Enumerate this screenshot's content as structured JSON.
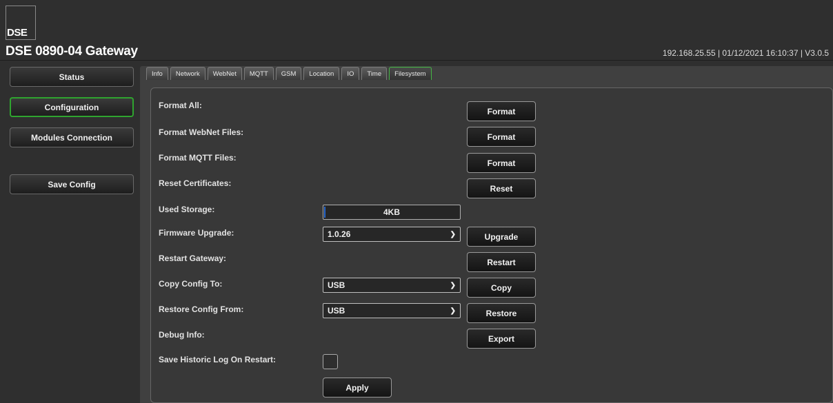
{
  "logo": {
    "text": "DSE"
  },
  "header": {
    "title": "DSE 0890-04 Gateway",
    "status": "192.168.25.55 | 01/12/2021 16:10:37 | V3.0.5"
  },
  "sidebar": {
    "items": [
      {
        "label": "Status"
      },
      {
        "label": "Configuration"
      },
      {
        "label": "Modules Connection"
      },
      {
        "label": "Save Config"
      }
    ]
  },
  "tabs": [
    {
      "label": "Info"
    },
    {
      "label": "Network"
    },
    {
      "label": "WebNet"
    },
    {
      "label": "MQTT"
    },
    {
      "label": "GSM"
    },
    {
      "label": "Location"
    },
    {
      "label": "IO"
    },
    {
      "label": "Time"
    },
    {
      "label": "Filesystem"
    }
  ],
  "filesystem": {
    "format_all": {
      "label": "Format All:",
      "button": "Format"
    },
    "format_webnet": {
      "label": "Format WebNet Files:",
      "button": "Format"
    },
    "format_mqtt": {
      "label": "Format MQTT Files:",
      "button": "Format"
    },
    "reset_certs": {
      "label": "Reset Certificates:",
      "button": "Reset"
    },
    "used_storage": {
      "label": "Used Storage:",
      "value": "4KB"
    },
    "firmware_upgrade": {
      "label": "Firmware Upgrade:",
      "selected": "1.0.26",
      "button": "Upgrade"
    },
    "restart_gateway": {
      "label": "Restart Gateway:",
      "button": "Restart"
    },
    "copy_config": {
      "label": "Copy Config To:",
      "selected": "USB",
      "button": "Copy"
    },
    "restore_config": {
      "label": "Restore Config From:",
      "selected": "USB",
      "button": "Restore"
    },
    "debug_info": {
      "label": "Debug Info:",
      "button": "Export"
    },
    "save_historic_log": {
      "label": "Save Historic Log On Restart:",
      "checked": false
    },
    "apply": "Apply"
  },
  "colors": {
    "active_border": "#2fa52f",
    "background": "#2f2f2f",
    "panel": "#383838"
  }
}
